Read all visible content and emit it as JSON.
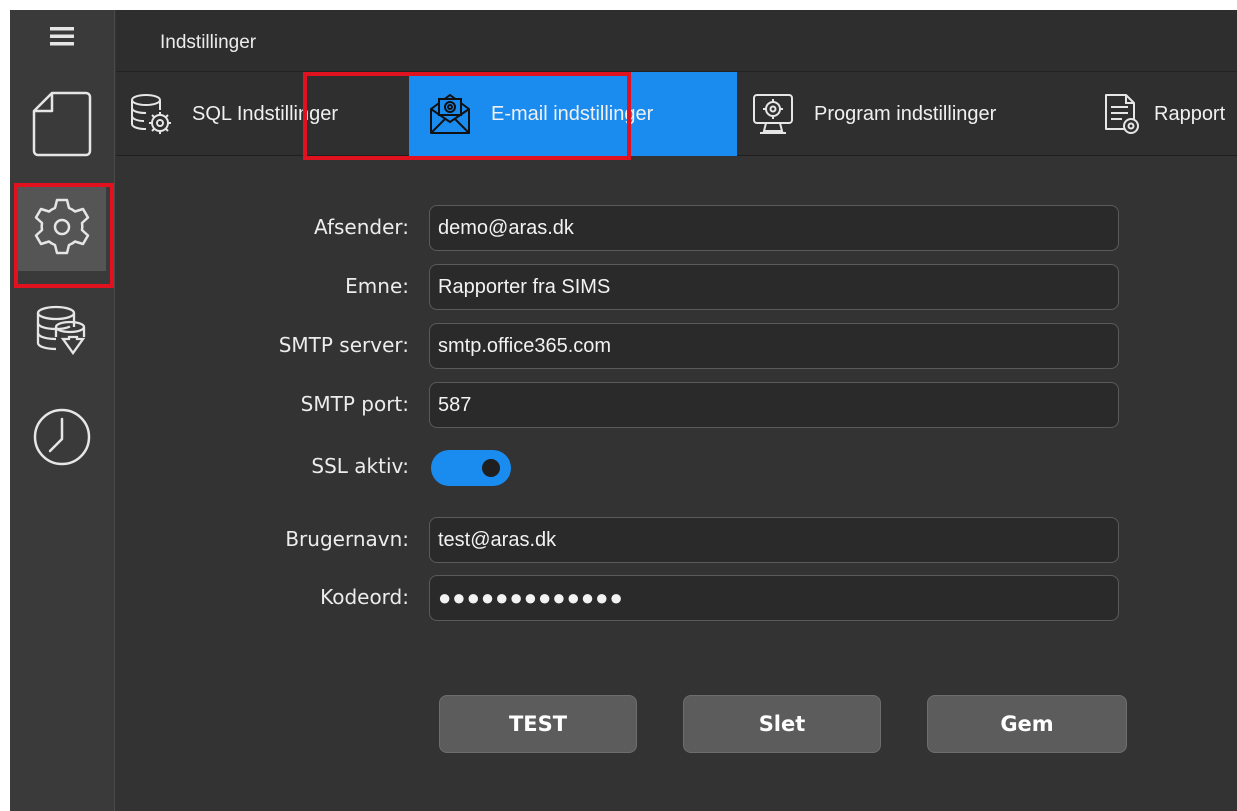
{
  "header": {
    "title": "Indstillinger"
  },
  "sidebar": {
    "items": [
      {
        "icon": "hamburger-menu-icon"
      },
      {
        "icon": "new-document-icon"
      },
      {
        "icon": "gear-icon",
        "active": true
      },
      {
        "icon": "database-download-icon"
      },
      {
        "icon": "clock-icon"
      }
    ]
  },
  "tabs": [
    {
      "label": "SQL Indstillinger",
      "icon": "database-gear-icon"
    },
    {
      "label": "E-mail indstillinger",
      "icon": "email-gear-icon",
      "active": true
    },
    {
      "label": "Program indstillinger",
      "icon": "monitor-gear-icon"
    },
    {
      "label": "Rapport",
      "icon": "report-gear-icon"
    }
  ],
  "form": {
    "sender": {
      "label": "Afsender:",
      "value": "demo@aras.dk"
    },
    "subject": {
      "label": "Emne:",
      "value": "Rapporter fra SIMS"
    },
    "smtp_server": {
      "label": "SMTP server:",
      "value": "smtp.office365.com"
    },
    "smtp_port": {
      "label": "SMTP port:",
      "value": "587"
    },
    "ssl": {
      "label": "SSL aktiv:",
      "enabled": true
    },
    "username": {
      "label": "Brugernavn:",
      "value": "test@aras.dk"
    },
    "password": {
      "label": "Kodeord:",
      "value": "●●●●●●●●●●●●●"
    }
  },
  "actions": {
    "test_label": "TEST",
    "delete_label": "Slet",
    "save_label": "Gem"
  },
  "colors": {
    "accent": "#1a8cf0",
    "highlight": "#e0121f",
    "background": "#333333",
    "sidebar": "#3a3a3a"
  }
}
